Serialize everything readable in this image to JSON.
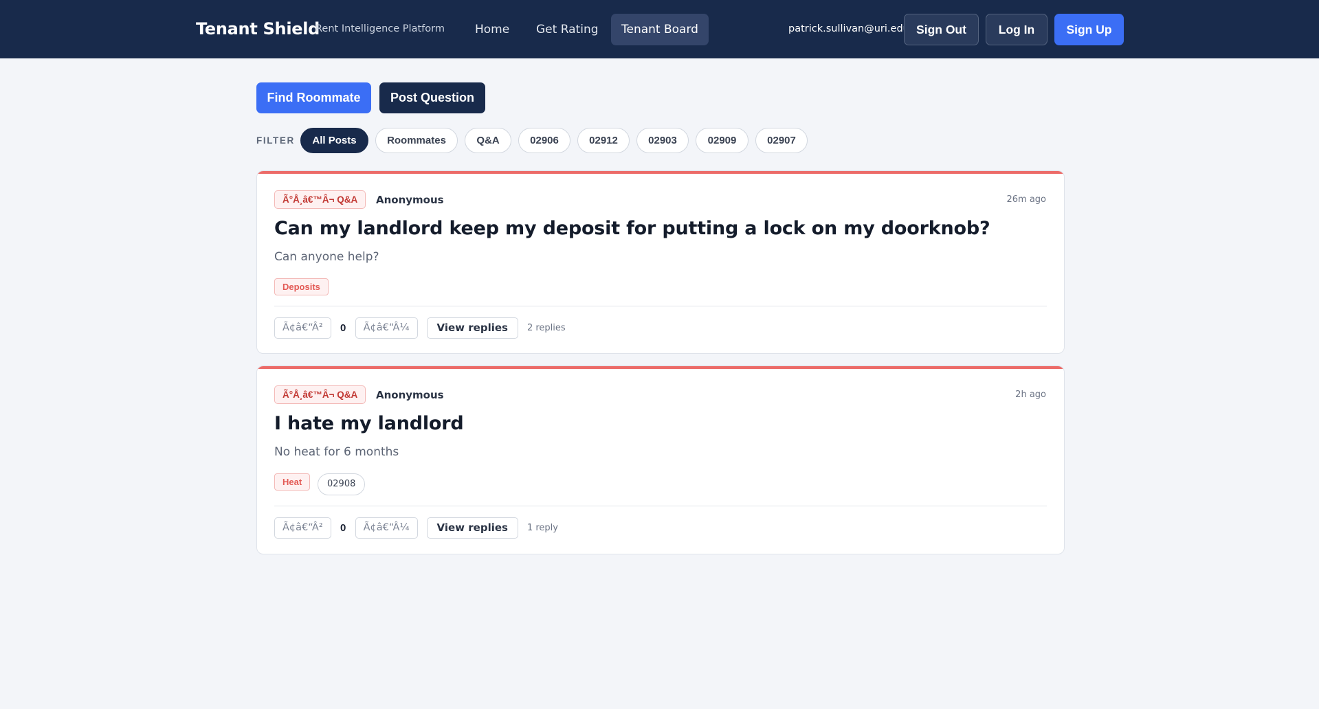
{
  "header": {
    "brand": "Tenant Shield",
    "tagline": "Rent Intelligence Platform",
    "nav": [
      {
        "label": "Home"
      },
      {
        "label": "Get Rating"
      },
      {
        "label": "Tenant Board",
        "active": true
      }
    ],
    "user_email": "patrick.sullivan@uri.edu",
    "sign_out_label": "Sign Out",
    "log_in_label": "Log In",
    "sign_up_label": "Sign Up"
  },
  "actions": {
    "find_roommate_label": "Find Roommate",
    "post_question_label": "Post Question"
  },
  "filter": {
    "label": "FILTER",
    "options": [
      {
        "label": "All Posts",
        "active": true
      },
      {
        "label": "Roommates"
      },
      {
        "label": "Q&A"
      },
      {
        "label": "02906"
      },
      {
        "label": "02912"
      },
      {
        "label": "02903"
      },
      {
        "label": "02909"
      },
      {
        "label": "02907"
      }
    ]
  },
  "posts": [
    {
      "type_badge": "Ã°Å¸â€™Â¬ Q&A",
      "author": "Anonymous",
      "time": "26m ago",
      "title": "Can my landlord keep my deposit for putting a lock on my doorknob?",
      "body": "Can anyone help?",
      "tags": [
        "Deposits"
      ],
      "upvote_label": "Ã¢â€“Â²",
      "score": "0",
      "downvote_label": "Ã¢â€“Â¼",
      "view_replies_label": "View replies",
      "reply_count": "2 replies"
    },
    {
      "type_badge": "Ã°Å¸â€™Â¬ Q&A",
      "author": "Anonymous",
      "time": "2h ago",
      "title": "I hate my landlord",
      "body": "No heat for 6 months",
      "tags": [
        "Heat"
      ],
      "zip": "02908",
      "upvote_label": "Ã¢â€“Â²",
      "score": "0",
      "downvote_label": "Ã¢â€“Â¼",
      "view_replies_label": "View replies",
      "reply_count": "1 reply"
    }
  ],
  "colors": {
    "nav_bg": "#182a4b",
    "accent_blue": "#3b6ef5",
    "card_accent": "#ec6b68",
    "page_bg": "#f3f5f9"
  }
}
